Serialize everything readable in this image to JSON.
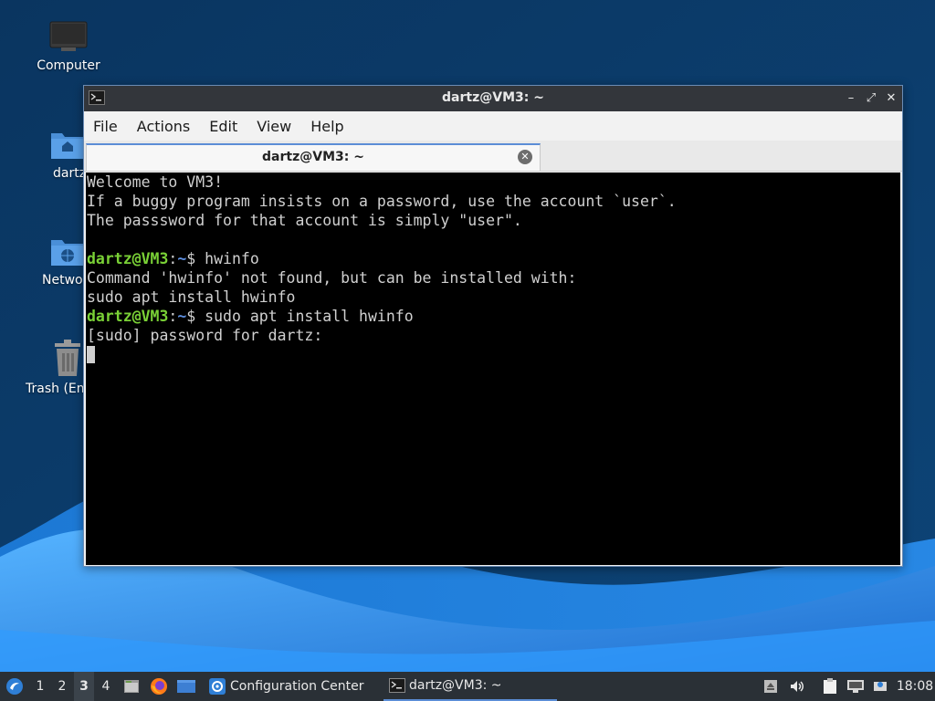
{
  "colors": {
    "accent": "#5b8dd6",
    "prompt_user": "#7ad136",
    "prompt_path": "#5e8fe0",
    "terminal_bg": "#000000",
    "terminal_fg": "#d0d0d0"
  },
  "desktop": {
    "icons": [
      {
        "label": "Computer",
        "icon": "monitor-icon"
      },
      {
        "label": "dartz",
        "icon": "home-folder-icon"
      },
      {
        "label": "Netwo",
        "icon": "network-folder-icon"
      },
      {
        "label": "Trash (Em",
        "icon": "trash-icon"
      }
    ]
  },
  "window": {
    "title": "dartz@VM3: ~",
    "menu": [
      "File",
      "Actions",
      "Edit",
      "View",
      "Help"
    ],
    "tab_title": "dartz@VM3: ~"
  },
  "terminal": {
    "lines": [
      "Welcome to VM3!",
      "If a buggy program insists on a password, use the account `user`.",
      "The passsword for that account is simply \"user\".",
      "",
      "Command 'hwinfo' not found, but can be installed with:",
      "sudo apt install hwinfo",
      "[sudo] password for dartz:"
    ],
    "prompt_user": "dartz@VM3",
    "prompt_sep": ":",
    "prompt_path": "~",
    "prompt_symbol": "$",
    "commands": [
      "hwinfo",
      "sudo apt install hwinfo"
    ]
  },
  "taskbar": {
    "workspaces": [
      "1",
      "2",
      "3",
      "4"
    ],
    "active_workspace": "3",
    "tasks": [
      {
        "label": "Configuration Center",
        "icon": "configuration-center-icon"
      },
      {
        "label": "dartz@VM3: ~",
        "icon": "terminal-icon"
      }
    ],
    "clock": "18:08"
  }
}
